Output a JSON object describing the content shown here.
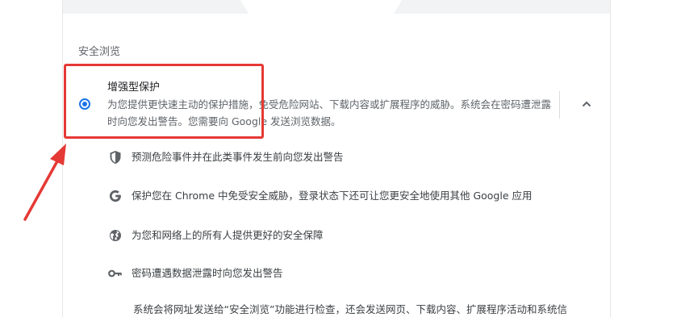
{
  "section": {
    "title": "安全浏览"
  },
  "option": {
    "title": "增强型保护",
    "description": "为您提供更快速主动的保护措施，免受危险网站、下载内容或扩展程序的威胁。系统会在密码遭泄露时向您发出警告。您需要向 Google 发送浏览数据。",
    "selected": true
  },
  "features": [
    {
      "icon": "shield-icon",
      "text": "预测危险事件并在此类事件发生前向您发出警告"
    },
    {
      "icon": "google-icon",
      "text": "保护您在 Chrome 中免受安全威胁，登录状态下还可让您更安全地使用其他 Google 应用"
    },
    {
      "icon": "globe-icon",
      "text": "为您和网络上的所有人提供更好的安全保障"
    },
    {
      "icon": "key-icon",
      "text": "密码遭遇数据泄露时向您发出警告"
    }
  ],
  "bottom_note": "系统会将网址发送给“安全浏览”功能进行检查，还会发送网页、下载内容、扩展程序活动和系统信",
  "colors": {
    "accent": "#1a73e8",
    "annotation": "#e53935"
  }
}
